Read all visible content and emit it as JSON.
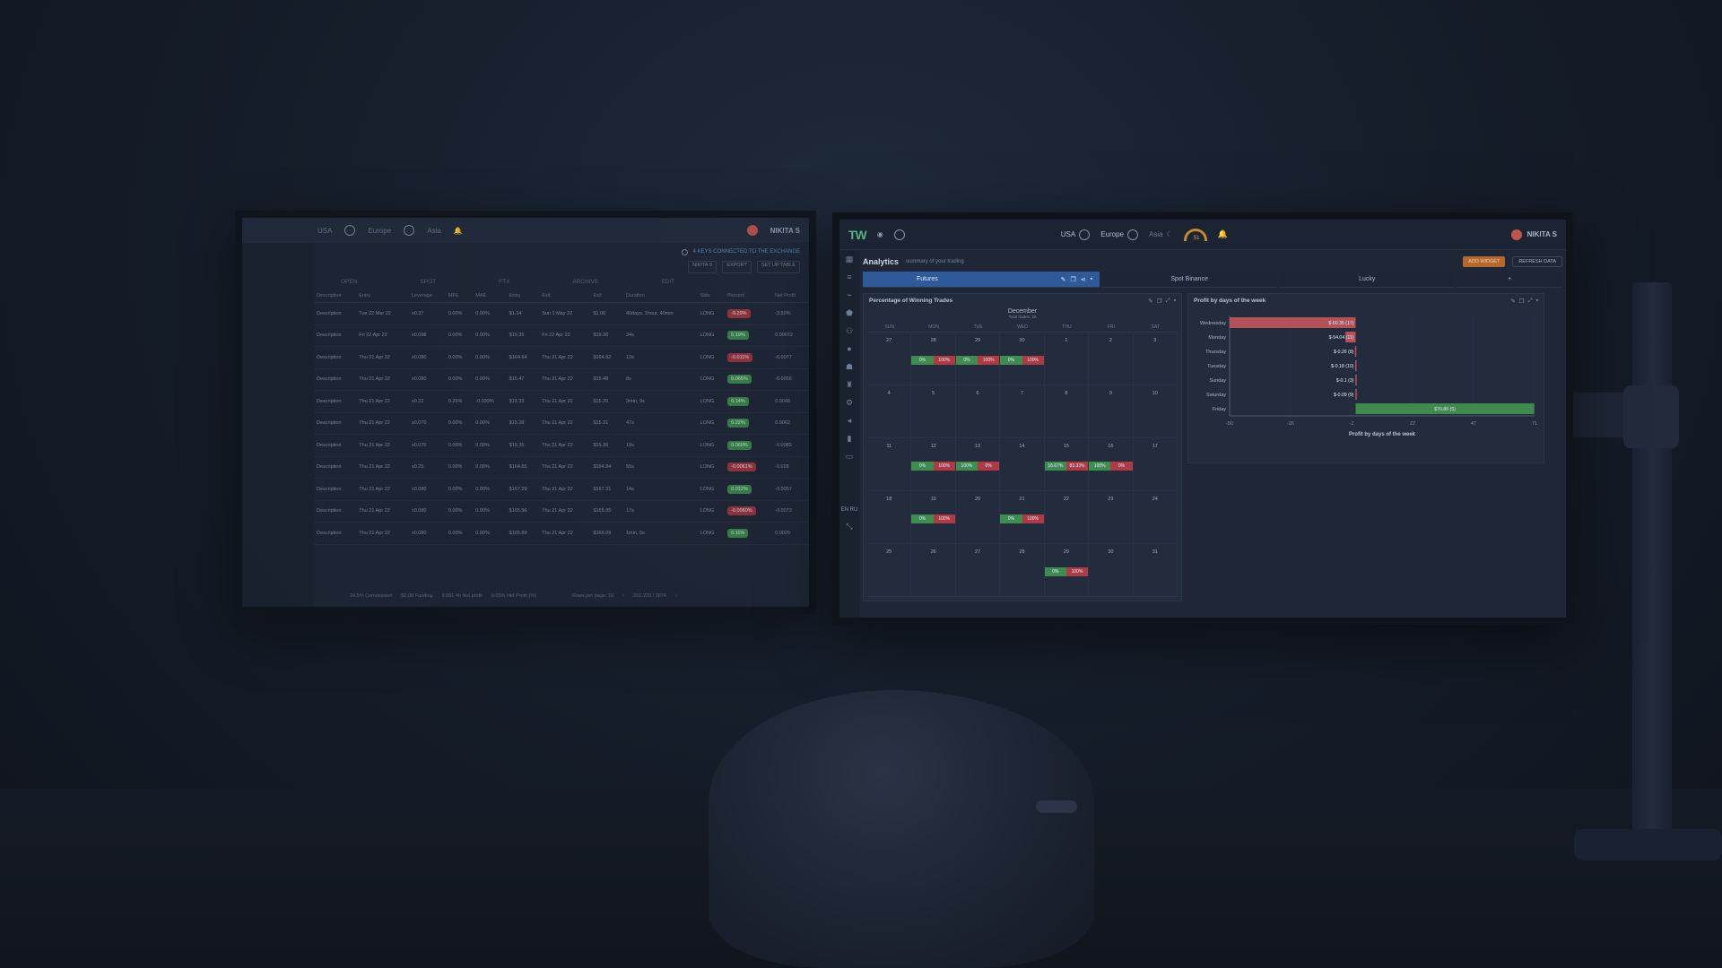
{
  "left_monitor": {
    "topbar": {
      "region1": "USA",
      "region2": "Europe",
      "region3": "Asia",
      "user": "NIKITA S"
    },
    "info": "4 KEYS CONNECTED TO THE EXCHANGE",
    "buttons": [
      "NIKITA S",
      "EXPORT",
      "SET UP TABLE"
    ],
    "tabs": [
      "OPEN",
      "SPOT",
      "FTX",
      "ARCHIVE"
    ],
    "edit": "EDIT",
    "columns": [
      "Description",
      "Entry",
      "Leverage",
      "MFE",
      "MAE",
      "Entry",
      "Exit",
      "Exit",
      "Duration",
      "Side",
      "Percent",
      "Net Profit"
    ],
    "rows": [
      {
        "desc": "Description",
        "date": "Tue 22 Mar 22",
        "lev": "x0.37",
        "mfe": "0.00%",
        "mae": "0.00%",
        "entry": "$1.14",
        "exit_date": "Sun 1 May 22",
        "exit": "$1.06",
        "dur": "40days, 1hour, 40min",
        "side": "LONG",
        "pct": "-9.29%",
        "pct_sign": "neg",
        "net": "-3.50%"
      },
      {
        "desc": "Description",
        "date": "Fri 22 Apr 22",
        "lev": "x0.098",
        "mfe": "0.00%",
        "mae": "0.00%",
        "entry": "$19.35",
        "exit_date": "Fri 22 Apr 22",
        "exit": "$19.36",
        "dur": "34s",
        "side": "LONG",
        "pct": "0.19%",
        "pct_sign": "pos",
        "net": "0.00072"
      },
      {
        "desc": "Description",
        "date": "Thu 21 Apr 22",
        "lev": "x0.080",
        "mfe": "0.00%",
        "mae": "0.00%",
        "entry": "$164.94",
        "exit_date": "Thu 21 Apr 22",
        "exit": "$164.92",
        "dur": "12s",
        "side": "LONG",
        "pct": "-0.011%",
        "pct_sign": "neg",
        "net": "-0.0077"
      },
      {
        "desc": "Description",
        "date": "Thu 21 Apr 22",
        "lev": "x0.080",
        "mfe": "0.00%",
        "mae": "0.00%",
        "entry": "$15.47",
        "exit_date": "Thu 21 Apr 22",
        "exit": "$15.48",
        "dur": "8s",
        "side": "LONG",
        "pct": "0.065%",
        "pct_sign": "pos",
        "net": "-0.0056"
      },
      {
        "desc": "Description",
        "date": "Thu 21 Apr 22",
        "lev": "x0.22",
        "mfe": "0.25%",
        "mae": "-0.039%",
        "entry": "$15.33",
        "exit_date": "Thu 21 Apr 22",
        "exit": "$15.35",
        "dur": "3min, 9s",
        "side": "LONG",
        "pct": "0.14%",
        "pct_sign": "pos",
        "net": "0.0048"
      },
      {
        "desc": "Description",
        "date": "Thu 21 Apr 22",
        "lev": "x0.070",
        "mfe": "0.00%",
        "mae": "0.00%",
        "entry": "$15.28",
        "exit_date": "Thu 21 Apr 22",
        "exit": "$15.31",
        "dur": "47s",
        "side": "LONG",
        "pct": "0.22%",
        "pct_sign": "pos",
        "net": "0.0062"
      },
      {
        "desc": "Description",
        "date": "Thu 21 Apr 22",
        "lev": "x0.070",
        "mfe": "0.00%",
        "mae": "0.00%",
        "entry": "$15.35",
        "exit_date": "Thu 21 Apr 22",
        "exit": "$15.36",
        "dur": "19s",
        "side": "LONG",
        "pct": "0.060%",
        "pct_sign": "pos",
        "net": "-0.0085"
      },
      {
        "desc": "Description",
        "date": "Thu 21 Apr 22",
        "lev": "x0.25",
        "mfe": "0.00%",
        "mae": "0.00%",
        "entry": "$164.85",
        "exit_date": "Thu 21 Apr 22",
        "exit": "$164.84",
        "dur": "55s",
        "side": "LONG",
        "pct": "-0.0061%",
        "pct_sign": "neg",
        "net": "-0.028"
      },
      {
        "desc": "Description",
        "date": "Thu 21 Apr 22",
        "lev": "x0.080",
        "mfe": "0.00%",
        "mae": "0.00%",
        "entry": "$167.29",
        "exit_date": "Thu 21 Apr 22",
        "exit": "$167.31",
        "dur": "14s",
        "side": "LONG",
        "pct": "0.012%",
        "pct_sign": "pos",
        "net": "-0.0057"
      },
      {
        "desc": "Description",
        "date": "Thu 21 Apr 22",
        "lev": "x0.080",
        "mfe": "0.00%",
        "mae": "0.00%",
        "entry": "$165.96",
        "exit_date": "Thu 21 Apr 22",
        "exit": "$165.95",
        "dur": "17s",
        "side": "LONG",
        "pct": "-0.0060%",
        "pct_sign": "neg",
        "net": "-0.0073"
      },
      {
        "desc": "Description",
        "date": "Thu 21 Apr 22",
        "lev": "x0.080",
        "mfe": "0.00%",
        "mae": "0.00%",
        "entry": "$165.89",
        "exit_date": "Thu 21 Apr 22",
        "exit": "$166.09",
        "dur": "1min, 5s",
        "side": "LONG",
        "pct": "0.11%",
        "pct_sign": "pos",
        "net": "0.0029"
      }
    ],
    "footer": [
      "24.5% Commission",
      "$0.08 Funding",
      "0.051 4h Net profit",
      "0.05% Net Profit (%)",
      "Rows per page: 10",
      "201-220 / 2874"
    ]
  },
  "right_monitor": {
    "topbar": {
      "region1": "USA",
      "region2": "Europe",
      "region3": "Asia",
      "gauge": "51",
      "user": "NIKITA S"
    },
    "page_title": "Analytics",
    "page_subtitle": "summary of your trading",
    "add_widget": "ADD WIDGET",
    "refresh": "REFRESH DATA",
    "tabs": [
      "Futures",
      "Spot Binance",
      "Lucky",
      "+"
    ],
    "lang": "EN RU",
    "calendar": {
      "title": "Percentage of Winning Trades",
      "month": "December",
      "total": "Total trades: 29",
      "dow": [
        "SUN",
        "MON",
        "TUE",
        "WED",
        "THU",
        "FRI",
        "SAT"
      ],
      "days": [
        "27",
        "28",
        "29",
        "30",
        "1",
        "2",
        "3",
        "4",
        "5",
        "6",
        "7",
        "8",
        "9",
        "10",
        "11",
        "12",
        "13",
        "14",
        "15",
        "16",
        "17",
        "18",
        "19",
        "20",
        "21",
        "22",
        "23",
        "24",
        "25",
        "26",
        "27",
        "28",
        "29",
        "30",
        "31"
      ],
      "chips": [
        {
          "cell": 1,
          "l": "0%",
          "r": "100%",
          "lc": "green",
          "rc": "red"
        },
        {
          "cell": 2,
          "l": "0%",
          "r": "100%",
          "lc": "green",
          "rc": "red"
        },
        {
          "cell": 3,
          "l": "0%",
          "r": "100%",
          "lc": "green",
          "rc": "red"
        },
        {
          "cell": 15,
          "l": "0%",
          "r": "100%",
          "lc": "green",
          "rc": "red"
        },
        {
          "cell": 16,
          "l": "100%",
          "r": "0%",
          "lc": "green",
          "rc": "red"
        },
        {
          "cell": 18,
          "l": "16.67%",
          "r": "83.33%",
          "lc": "green",
          "rc": "red"
        },
        {
          "cell": 19,
          "l": "100%",
          "r": "0%",
          "lc": "green",
          "rc": "red"
        },
        {
          "cell": 22,
          "l": "0%",
          "r": "100%",
          "lc": "green",
          "rc": "red"
        },
        {
          "cell": 24,
          "l": "0%",
          "r": "100%",
          "lc": "green",
          "rc": "red"
        },
        {
          "cell": 32,
          "l": "0%",
          "r": "100%",
          "lc": "green",
          "rc": "red"
        }
      ]
    }
  },
  "chart_data": {
    "type": "bar",
    "orientation": "horizontal",
    "title": "Profit by days of the week",
    "xlabel": "Profit by days of the week",
    "categories": [
      "Wednesday",
      "Monday",
      "Thursday",
      "Tuesday",
      "Sunday",
      "Saturday",
      "Friday"
    ],
    "values": [
      -50,
      -4.04,
      -0.26,
      -0.18,
      -0.1,
      -0.09,
      70.86
    ],
    "labels": [
      "$-50.35 (17)",
      "$-54.04 (11)",
      "$-0.26 (8)",
      "$-0.18 (10)",
      "$-0.1 (3)",
      "$-0.09 (9)",
      "$70.86 (5)"
    ],
    "colors": [
      "#b4525a",
      "#b4525a",
      "#b4525a",
      "#b4525a",
      "#b4525a",
      "#b4525a",
      "#3f8b4d"
    ],
    "xticks": [
      "-50",
      "-26",
      "-2",
      "22",
      "47",
      "71"
    ],
    "xlim": [
      -50,
      71
    ],
    "grid": true
  }
}
